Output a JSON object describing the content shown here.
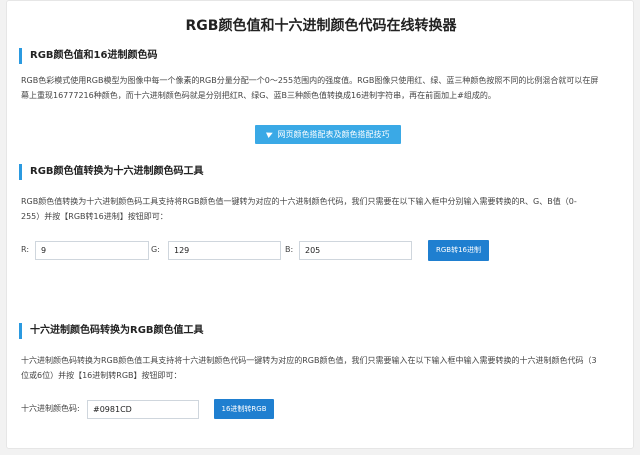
{
  "page": {
    "title": "RGB颜色值和十六进制颜色代码在线转换器"
  },
  "section1": {
    "heading": "RGB颜色值和16进制颜色码",
    "line1": "RGB色彩模式使用RGB模型为图像中每一个像素的RGB分量分配一个0～255范围内的强度值。RGB图像只使用红、绿、蓝三种颜色按照不同的比例混合就可以在屏",
    "line2": "幕上重现16777216种颜色，而十六进制颜色码就是分别把红R、绿G、蓝B三种颜色值转换成16进制字符串，再在前面加上#组成的。",
    "tip_button": "网页颜色搭配表及颜色搭配技巧"
  },
  "section2": {
    "heading": "RGB颜色值转换为十六进制颜色码工具",
    "line1": "RGB颜色值转换为十六进制颜色码工具支持将RGB颜色值一键转为对应的十六进制颜色代码，我们只需要在以下输入框中分别输入需要转换的R、G、B值（0-",
    "line2": "255）并按【RGB转16进制】按钮即可：",
    "r_label": "R:",
    "r_value": "9",
    "g_label": "G:",
    "g_value": "129",
    "b_label": "B:",
    "b_value": "205",
    "convert_button": "RGB转16进制"
  },
  "section3": {
    "heading": "十六进制颜色码转换为RGB颜色值工具",
    "line1": "十六进制颜色码转换为RGB颜色值工具支持将十六进制颜色代码一键转为对应的RGB颜色值，我们只需要输入在以下输入框中输入需要转换的十六进制颜色代码（3",
    "line2": "位或6位）并按【16进制转RGB】按钮即可：",
    "hex_label": "十六进制颜色码:",
    "hex_value": "#0981CD",
    "convert_button": "16进制转RGB"
  },
  "colors": {
    "accent": "#2b9ae0",
    "button": "#1f7fd0",
    "tip_button": "#3aa9e6"
  },
  "icons": {
    "tip": "send-icon"
  }
}
